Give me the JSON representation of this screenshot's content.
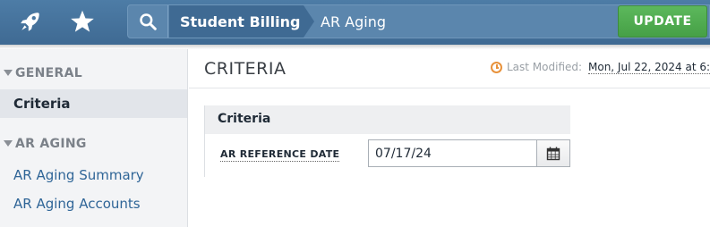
{
  "header": {
    "breadcrumb": {
      "primary": "Student Billing",
      "secondary": "AR Aging"
    },
    "update_label": "UPDATE",
    "icons": [
      "rocket-icon",
      "star-icon",
      "search-icon"
    ]
  },
  "sidebar": {
    "sections": [
      {
        "title": "GENERAL",
        "items": [
          {
            "label": "Criteria",
            "active": true
          }
        ]
      },
      {
        "title": "AR AGING",
        "items": [
          {
            "label": "AR Aging Summary"
          },
          {
            "label": "AR Aging Accounts"
          }
        ]
      }
    ]
  },
  "main": {
    "title": "CRITERIA",
    "last_modified_label": "Last Modified:",
    "last_modified_value": "Mon, Jul 22, 2024 at 6:",
    "panel": {
      "title": "Criteria",
      "field_label": "AR REFERENCE DATE",
      "field_value": "07/17/24"
    }
  },
  "colors": {
    "header": "#4a78a2",
    "update": "#4cae4c",
    "link": "#2f6597",
    "accent_clock": "#e8923b"
  }
}
